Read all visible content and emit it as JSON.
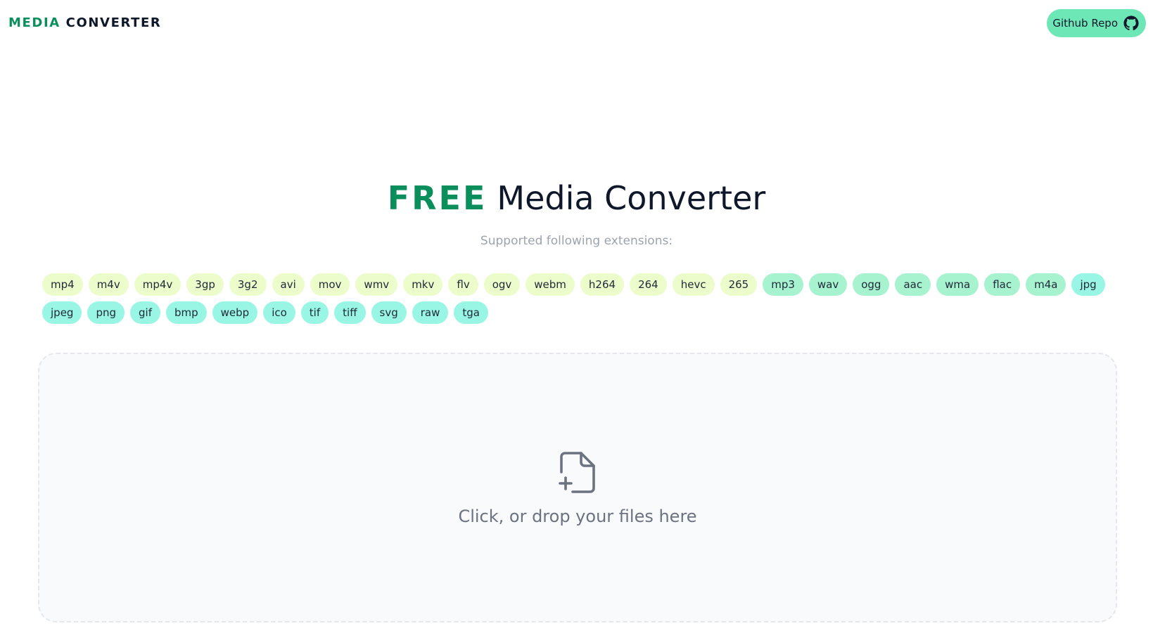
{
  "header": {
    "logo_accent": "MEDIA",
    "logo_rest": "CONVERTER",
    "github_label": "Github Repo",
    "github_icon": "github-icon"
  },
  "hero": {
    "title_accent": "FREE",
    "title_rest": "Media Converter",
    "subtitle": "Supported following extensions:"
  },
  "extensions": {
    "video": [
      "mp4",
      "m4v",
      "mp4v",
      "3gp",
      "3g2",
      "avi",
      "mov",
      "wmv",
      "mkv",
      "flv",
      "ogv",
      "webm",
      "h264",
      "264",
      "hevc",
      "265"
    ],
    "audio": [
      "mp3",
      "wav",
      "ogg",
      "aac",
      "wma",
      "flac",
      "m4a"
    ],
    "image": [
      "jpg",
      "jpeg",
      "png",
      "gif",
      "bmp",
      "webp",
      "ico",
      "tif",
      "tiff",
      "svg",
      "raw",
      "tga"
    ]
  },
  "dropzone": {
    "text": "Click, or drop your files here",
    "icon": "file-plus-icon"
  },
  "colors": {
    "accent": "#0a8f5c",
    "github_button": "#6ee7b7",
    "video_chip": "#ecfccb",
    "audio_chip": "#a7f3d0",
    "image_chip": "#99f6e4",
    "dropzone_bg": "#f8fafc"
  }
}
